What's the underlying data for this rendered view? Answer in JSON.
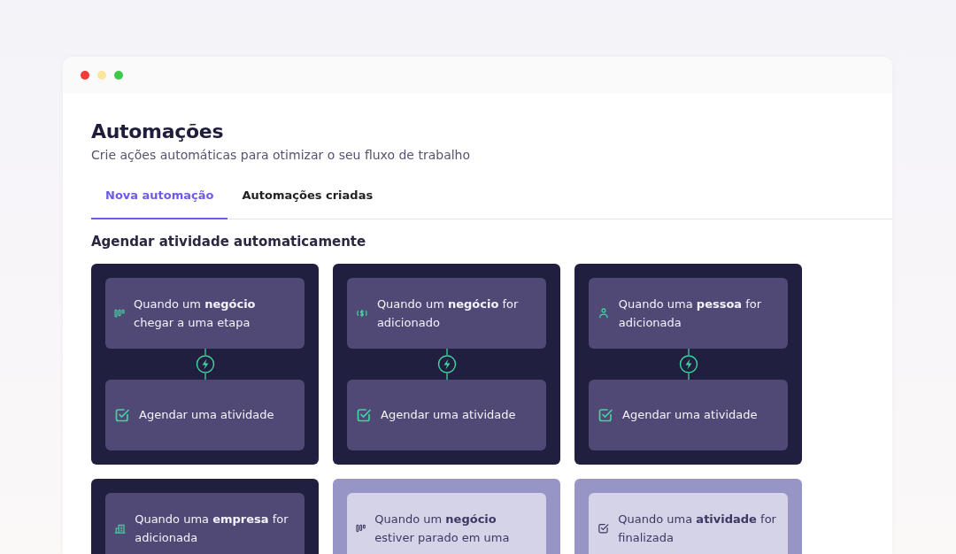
{
  "window": {
    "controls": [
      {
        "color": "#f23b36"
      },
      {
        "color": "#fbe49b"
      },
      {
        "color": "#3ec94a"
      }
    ]
  },
  "title": "Automações",
  "subtitle": "Crie ações automáticas para otimizar o seu fluxo de trabalho",
  "tabs": [
    {
      "label": "Nova automação",
      "selected": true
    },
    {
      "label": "Automações criadas",
      "selected": false
    }
  ],
  "section_title": "Agendar atividade automaticamente",
  "cards": [
    {
      "disabled": false,
      "trigger": {
        "kind": "stage",
        "text": "Quando um **negócio** chegar a uma etapa"
      },
      "action": {
        "text": "Agendar uma atividade"
      }
    },
    {
      "disabled": false,
      "trigger": {
        "kind": "deal",
        "text": "Quando um **negócio** for adicionado"
      },
      "action": {
        "text": "Agendar uma atividade"
      }
    },
    {
      "disabled": false,
      "trigger": {
        "kind": "person",
        "text": "Quando uma **pessoa** for adicionada"
      },
      "action": {
        "text": "Agendar uma atividade"
      }
    },
    {
      "disabled": false,
      "trigger": {
        "kind": "company",
        "text": "Quando uma **empresa** for adicionada"
      }
    },
    {
      "disabled": true,
      "trigger": {
        "kind": "stage",
        "text": "Quando um **negócio** estiver parado em uma"
      }
    },
    {
      "disabled": true,
      "trigger": {
        "kind": "activity",
        "text": "Quando uma **atividade** for finalizada"
      }
    }
  ]
}
